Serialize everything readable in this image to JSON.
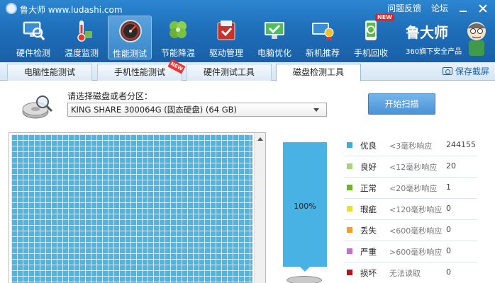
{
  "window": {
    "title": "鲁大师 www.ludashi.com",
    "links": [
      "问题反馈",
      "论坛"
    ]
  },
  "toolbar": {
    "items": [
      {
        "label": "硬件检测",
        "icon": "computer-magnifier-icon"
      },
      {
        "label": "温度监测",
        "icon": "thermometer-icon"
      },
      {
        "label": "性能测试",
        "icon": "speedometer-icon",
        "active": true
      },
      {
        "label": "节能降温",
        "icon": "clover-leaf-icon"
      },
      {
        "label": "驱动管理",
        "icon": "driver-box-icon"
      },
      {
        "label": "电脑优化",
        "icon": "monitor-check-icon"
      },
      {
        "label": "新机推荐",
        "icon": "computer-medal-icon"
      },
      {
        "label": "手机回收",
        "icon": "phone-recycle-icon",
        "badge": "NEW"
      }
    ],
    "brand": {
      "name": "鲁大师",
      "slogan": "360旗下安全产品"
    }
  },
  "tabs": [
    {
      "label": "电脑性能测试"
    },
    {
      "label": "手机性能测试",
      "badge": "NEW"
    },
    {
      "label": "硬件测试工具"
    },
    {
      "label": "磁盘检测工具",
      "active": true
    }
  ],
  "save_screenshot": "保存截屏",
  "disk": {
    "select_label": "请选择磁盘或者分区：",
    "selected": "KING SHARE 300064G (固态硬盘) (64 GB)",
    "scan_button": "开始扫描"
  },
  "progress": {
    "value": 1.0,
    "label": "100%"
  },
  "legend": [
    {
      "name": "优良",
      "range": "<3毫秒响应",
      "count": "244155",
      "color": "#3fa9e0"
    },
    {
      "name": "良好",
      "range": "<12毫秒响应",
      "count": "20",
      "color": "#a6d57c"
    },
    {
      "name": "正常",
      "range": "<20毫秒响应",
      "count": "1",
      "color": "#6fb424"
    },
    {
      "name": "瑕疵",
      "range": "<120毫秒响应",
      "count": "0",
      "color": "#e8e033"
    },
    {
      "name": "丢失",
      "range": "<600毫秒响应",
      "count": "0",
      "color": "#f0a025"
    },
    {
      "name": "严重",
      "range": ">600毫秒响应",
      "count": "0",
      "color": "#c66ec8"
    },
    {
      "name": "损坏",
      "range": "无法读取",
      "count": "0",
      "color": "#b01818"
    }
  ]
}
